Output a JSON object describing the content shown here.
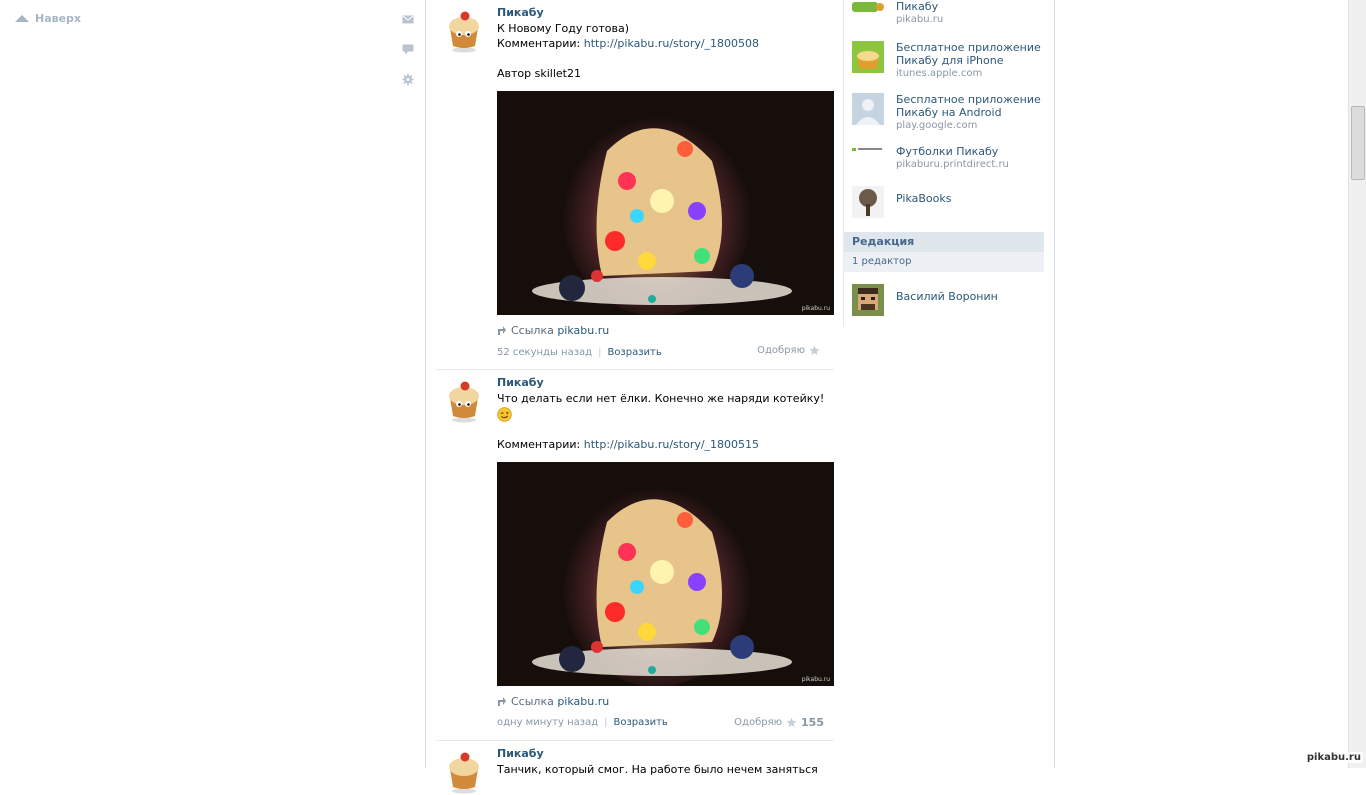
{
  "gutter": {
    "up_label": "Наверх"
  },
  "icons": {
    "mail": "mail-icon",
    "comment": "comment-icon",
    "settings": "gear-icon"
  },
  "posts": [
    {
      "author": "Пикабу",
      "line1": "К Новому Году готова)",
      "comments_label": "Комментарии: ",
      "comments_url": "http://pikabu.ru/story/_1800508",
      "author_credit": "Автор skillet21",
      "photo_watermark": "pikabu.ru",
      "source_label": "Ссылка ",
      "source_link": "pikabu.ru",
      "time": "52 секунды назад",
      "sep": "|",
      "reply": "Возразить",
      "like_label": "Одобряю",
      "like_count": ""
    },
    {
      "author": "Пикабу",
      "line1": "Что делать если нет ёлки. Конечно же наряди котейку!",
      "comments_label": "Комментарии: ",
      "comments_url": "http://pikabu.ru/story/_1800515",
      "photo_watermark": "pikabu.ru",
      "source_label": "Ссылка ",
      "source_link": "pikabu.ru",
      "time": "одну минуту назад",
      "sep": "|",
      "reply": "Возразить",
      "like_label": "Одобряю",
      "like_count": "155"
    },
    {
      "author": "Пикабу",
      "line1": "Танчик, который смог. На работе было нечем заняться"
    }
  ],
  "sidebar": {
    "links": [
      {
        "title": "Пикабу",
        "domain": "pikabu.ru",
        "thumb": "pikabu-logo"
      },
      {
        "title": "Бесплатное приложение Пикабу для iPhone",
        "domain": "itunes.apple.com",
        "thumb": "iphone-app-icon"
      },
      {
        "title": "Бесплатное приложение Пикабу на Android",
        "domain": "play.google.com",
        "thumb": "default-avatar"
      },
      {
        "title": "Футболки Пикабу",
        "domain": "pikaburu.printdirect.ru",
        "thumb": "printdirect-logo"
      },
      {
        "title": "PikaBooks",
        "domain": "",
        "thumb": "tree-icon"
      }
    ],
    "editors_header": "Редакция",
    "editors_count": "1 редактор",
    "editor_name": "Василий Воронин"
  },
  "watermark": "pikabu.ru",
  "colors": {
    "link": "#2b587a",
    "muted": "#8a97a5",
    "header_bg": "#dfe6ec"
  }
}
